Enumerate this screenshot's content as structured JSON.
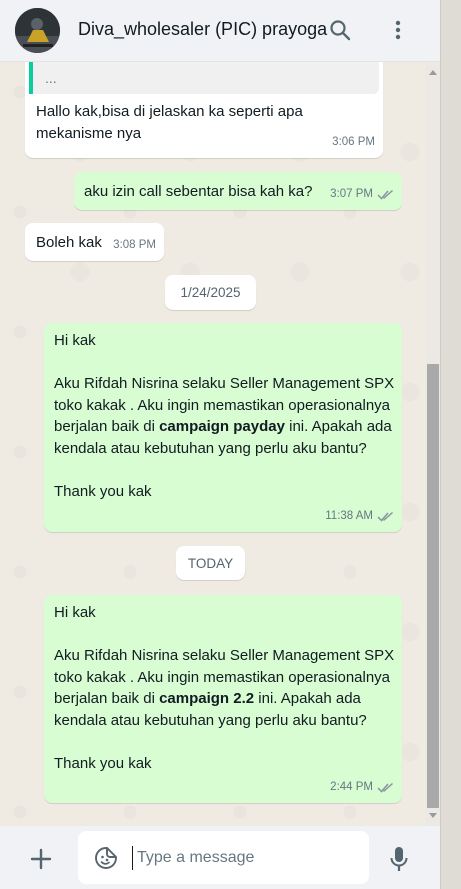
{
  "header": {
    "contact_name": "Diva_wholesaler (PIC) prayoga",
    "search_icon": "search-icon",
    "menu_icon": "kebab-menu-icon"
  },
  "messages": [
    {
      "direction": "incoming",
      "quote_preview": "...",
      "text": "Hallo kak,bisa di jelaskan ka seperti apa mekanisme nya",
      "time": "3:06 PM"
    },
    {
      "direction": "outgoing",
      "text": "aku izin call sebentar bisa kah ka?",
      "time": "3:07 PM",
      "status": "read"
    },
    {
      "direction": "incoming",
      "text": "Boleh kak",
      "time": "3:08 PM"
    },
    {
      "type": "date",
      "label": "1/24/2025"
    },
    {
      "direction": "outgoing",
      "greeting": "Hi kak",
      "body_before_bold": "Aku Rifdah Nisrina selaku Seller Management SPX toko kakak . Aku ingin memastikan operasionalnya berjalan baik di ",
      "bold": "campaign payday",
      "body_after_bold": " ini. Apakah ada kendala atau kebutuhan yang perlu aku bantu?",
      "closing": "Thank you kak",
      "time": "11:38 AM",
      "status": "read"
    },
    {
      "type": "date",
      "label": "TODAY"
    },
    {
      "direction": "outgoing",
      "greeting": "Hi kak",
      "body_before_bold": "Aku Rifdah Nisrina selaku Seller Management SPX toko kakak . Aku ingin memastikan operasionalnya berjalan baik di ",
      "bold": "campaign 2.2",
      "body_after_bold": " ini. Apakah ada kendala atau kebutuhan yang perlu aku bantu?",
      "closing": "Thank you kak",
      "time": "2:44 PM",
      "status": "read"
    }
  ],
  "composer": {
    "placeholder": "Type a message",
    "value": ""
  },
  "colors": {
    "outgoing_bubble": "#d9fdd3",
    "incoming_bubble": "#ffffff",
    "chat_background": "#efeae2",
    "header_background": "#f0f2f5",
    "read_ticks": "#8696a0",
    "quote_bar": "#06cf9c"
  }
}
